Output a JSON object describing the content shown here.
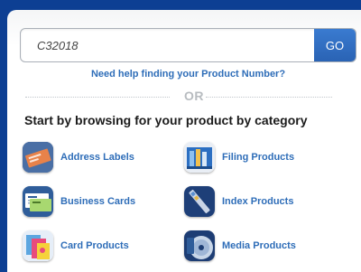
{
  "search": {
    "value": "C32018",
    "go_label": "GO"
  },
  "help_link": "Need help finding your Product Number?",
  "divider_text": "OR",
  "browse_title": "Start by browsing for your product by category",
  "categories": [
    {
      "label": "Address Labels",
      "icon": "address-labels-icon"
    },
    {
      "label": "Filing Products",
      "icon": "filing-products-icon"
    },
    {
      "label": "Business Cards",
      "icon": "business-cards-icon"
    },
    {
      "label": "Index Products",
      "icon": "index-products-icon"
    },
    {
      "label": "Card Products",
      "icon": "card-products-icon"
    },
    {
      "label": "Media Products",
      "icon": "media-products-icon"
    }
  ]
}
